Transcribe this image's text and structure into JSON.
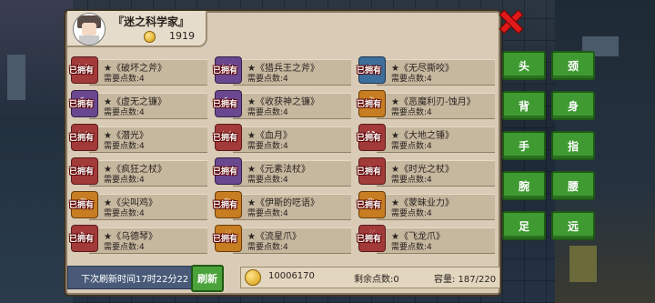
{
  "player": {
    "name": "『迷之科学家』",
    "gold": "1919"
  },
  "items": [
    {
      "owned": "已拥有",
      "title": "★《破坏之斧》",
      "cost": "需要点数:4",
      "color": "red",
      "glyph": "⚔"
    },
    {
      "owned": "已拥有",
      "title": "★《猎兵王之斧》",
      "cost": "需要点数:4",
      "color": "purple",
      "glyph": "⚔"
    },
    {
      "owned": "已拥有",
      "title": "★《无尽撕咬》",
      "cost": "需要点数:4",
      "color": "blue",
      "glyph": "✦"
    },
    {
      "owned": "已拥有",
      "title": "★《虚无之镰》",
      "cost": "需要点数:4",
      "color": "purple",
      "glyph": "☾"
    },
    {
      "owned": "已拥有",
      "title": "★《收获神之镰》",
      "cost": "需要点数:4",
      "color": "purple",
      "glyph": "☾"
    },
    {
      "owned": "已拥有",
      "title": "★《恶魔利刃-蚀月》",
      "cost": "需要点数:4",
      "color": "gold",
      "glyph": "☽"
    },
    {
      "owned": "已拥有",
      "title": "★《潜光》",
      "cost": "需要点数:4",
      "color": "red",
      "glyph": "⚔"
    },
    {
      "owned": "已拥有",
      "title": "★《血月》",
      "cost": "需要点数:4",
      "color": "red",
      "glyph": "⚔"
    },
    {
      "owned": "已拥有",
      "title": "★《大地之锤》",
      "cost": "需要点数:4",
      "color": "red",
      "glyph": "⚒"
    },
    {
      "owned": "已拥有",
      "title": "★《疯狂之杖》",
      "cost": "需要点数:4",
      "color": "red",
      "glyph": "✧"
    },
    {
      "owned": "已拥有",
      "title": "★《元素法杖》",
      "cost": "需要点数:4",
      "color": "purple",
      "glyph": "✧"
    },
    {
      "owned": "已拥有",
      "title": "★《时光之杖》",
      "cost": "需要点数:4",
      "color": "red",
      "glyph": "✧"
    },
    {
      "owned": "已拥有",
      "title": "★《尖叫鸡》",
      "cost": "需要点数:4",
      "color": "gold",
      "glyph": "✺"
    },
    {
      "owned": "已拥有",
      "title": "★《伊斯的呓语》",
      "cost": "需要点数:4",
      "color": "gold",
      "glyph": "✺"
    },
    {
      "owned": "已拥有",
      "title": "★《蒙昧业力》",
      "cost": "需要点数:4",
      "color": "gold",
      "glyph": "✺"
    },
    {
      "owned": "已拥有",
      "title": "★《乌德琴》",
      "cost": "需要点数:4",
      "color": "red",
      "glyph": "♪"
    },
    {
      "owned": "已拥有",
      "title": "★《流星爪》",
      "cost": "需要点数:4",
      "color": "gold",
      "glyph": "☄"
    },
    {
      "owned": "已拥有",
      "title": "★《飞龙爪》",
      "cost": "需要点数:4",
      "color": "red",
      "glyph": "☄"
    }
  ],
  "filters": [
    "头",
    "颈",
    "背",
    "身",
    "手",
    "指",
    "腕",
    "腰",
    "足",
    "远"
  ],
  "bottom": {
    "refresh_info": "下次刷新时间17时22分22",
    "refresh_button": "刷新",
    "money": "10006170",
    "remaining_points": "剩余点数:0",
    "capacity": "容量:   187/220"
  }
}
